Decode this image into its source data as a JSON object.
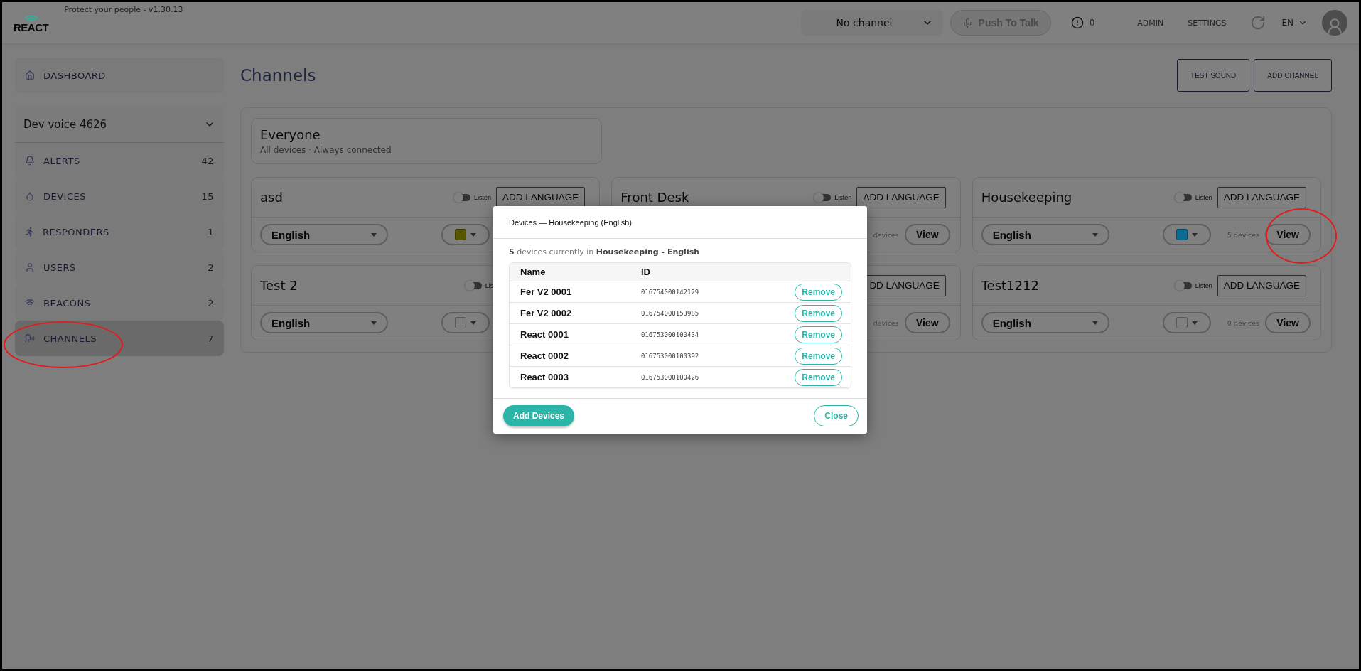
{
  "header": {
    "logo": "REACT",
    "tagline": "Protect your people - v1.30.13",
    "channel_select": "No channel",
    "push_to_talk": {
      "label": "Push To Talk",
      "disabled": true
    },
    "alerts_count": "0",
    "nav": [
      "ADMIN",
      "SETTINGS"
    ],
    "language": "EN"
  },
  "sidebar": {
    "dashboard": "DASHBOARD",
    "site": "Dev voice 4626",
    "items": [
      {
        "kind": "bell",
        "label": "ALERTS",
        "count": "42",
        "selected": false
      },
      {
        "kind": "device",
        "label": "DEVICES",
        "count": "15",
        "selected": false
      },
      {
        "kind": "runner",
        "label": "RESPONDERS",
        "count": "1",
        "selected": false
      },
      {
        "kind": "user",
        "label": "USERS",
        "count": "2",
        "selected": false
      },
      {
        "kind": "wifi",
        "label": "BEACONS",
        "count": "2",
        "selected": false
      },
      {
        "kind": "speaker",
        "label": "CHANNELS",
        "count": "7",
        "selected": true
      }
    ]
  },
  "page": {
    "title": "Channels",
    "buttons": [
      "TEST SOUND",
      "ADD CHANNEL"
    ]
  },
  "everyone": {
    "title": "Everyone",
    "subtitle": "All devices · Always connected"
  },
  "channels": [
    {
      "name": "asd",
      "listen": false,
      "listen_label": "Listen",
      "add_language": "ADD LANGUAGE",
      "language": "English",
      "color": "#585800"
    },
    {
      "name": "Front Desk",
      "listen": false,
      "listen_label": "Listen",
      "add_language": "ADD LANGUAGE",
      "devices": "devices",
      "view": "View"
    },
    {
      "name": "Housekeeping",
      "listen": false,
      "listen_label": "Listen",
      "add_language": "ADD LANGUAGE",
      "language": "English",
      "color": "#0a6c94",
      "devices": "5 devices",
      "view": "View"
    },
    {
      "name": "Test 2",
      "listen": false,
      "listen_label": "Lis",
      "language": "English",
      "color": "#808080"
    },
    {
      "add_language": "DD LANGUAGE",
      "devices": "devices",
      "view": "View"
    },
    {
      "name": "Test1212",
      "listen": false,
      "listen_label": "Listen",
      "add_language": "ADD LANGUAGE",
      "language": "English",
      "color": "#808080",
      "devices": "0 devices",
      "view": "View"
    }
  ],
  "modal": {
    "title": "Devices — Housekeeping (English)",
    "summary": "**5** devices currently in **Housekeeping - English**",
    "columns": [
      "Name",
      "ID"
    ],
    "rows": [
      {
        "name": "Fer V2 0001",
        "id": "016754000142129",
        "action": "Remove"
      },
      {
        "name": "Fer V2 0002",
        "id": "016754000153985",
        "action": "Remove"
      },
      {
        "name": "React 0001",
        "id": "016753000100434",
        "action": "Remove"
      },
      {
        "name": "React 0002",
        "id": "016753000100392",
        "action": "Remove"
      },
      {
        "name": "React 0003",
        "id": "016753000100426",
        "action": "Remove"
      }
    ],
    "buttons": [
      "Add Devices",
      "Close"
    ]
  }
}
